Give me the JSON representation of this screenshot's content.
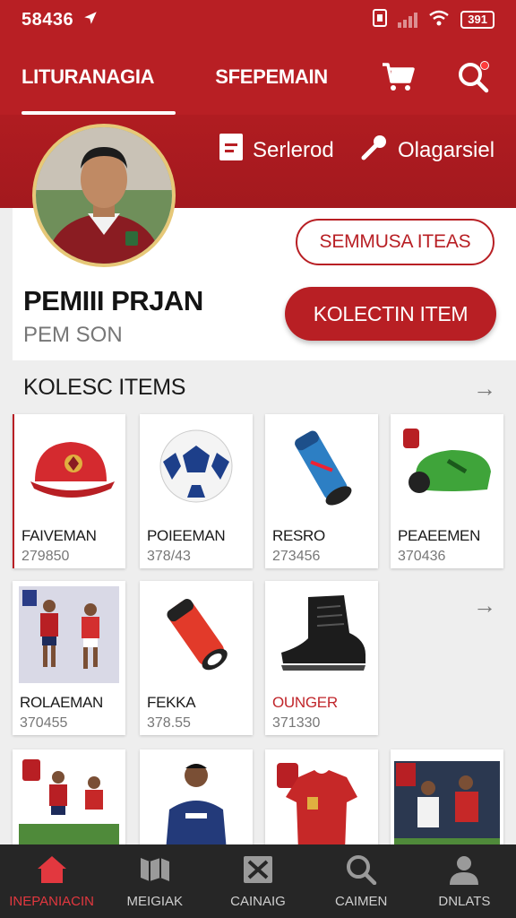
{
  "status": {
    "time": "58436",
    "battery": "391"
  },
  "nav": {
    "tab1": "LITURANAGIA",
    "tab2": "SFEPEMAIN"
  },
  "quick": {
    "item1": "Serlerod",
    "item2": "Olagarsiel"
  },
  "profile": {
    "name": "PEMIII PRJAN",
    "subtitle": "PEM SON",
    "outline_button": "SEMMUSA ITEAS",
    "primary_button": "KOLECTIN ITEM"
  },
  "section": {
    "title": "KOLESC ITEMS"
  },
  "items": [
    {
      "title": "FAIVEMAN",
      "price": "279850",
      "icon": "cap-icon"
    },
    {
      "title": "POIEEMAN",
      "price": "378/43",
      "icon": "ball-icon"
    },
    {
      "title": "RESRO",
      "price": "273456",
      "icon": "bottle-icon"
    },
    {
      "title": "PEAEEMEN",
      "price": "370436",
      "icon": "shin-guard-icon"
    },
    {
      "title": "ROLAEMAN",
      "price": "370455",
      "icon": "players-photo"
    },
    {
      "title": "FEKKA",
      "price": "378.55",
      "icon": "bottle-icon"
    },
    {
      "title": "OUNGER",
      "price": "371330",
      "icon": "boot-icon"
    }
  ],
  "bottom_nav": [
    "INEPANIACIN",
    "MEIGIAK",
    "CAINAIG",
    "CAIMEN",
    "DNLATS"
  ],
  "colors": {
    "brand": "#b81f24",
    "nav_bg": "#262626",
    "active": "#e2383f"
  }
}
